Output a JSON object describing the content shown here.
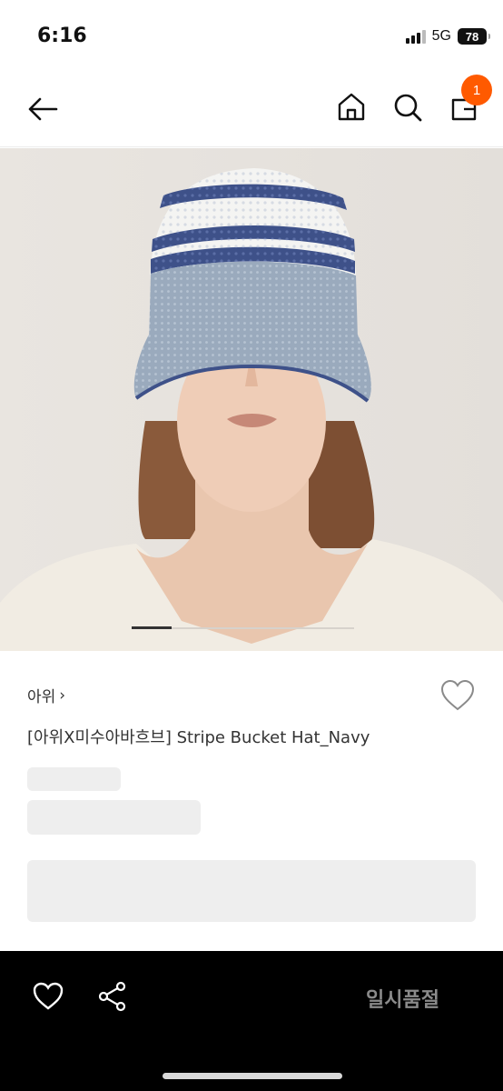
{
  "status_bar": {
    "time": "6:16",
    "network": "5G",
    "battery": "78"
  },
  "header": {
    "back_icon": "arrow-left-icon",
    "home_icon": "home-icon",
    "search_icon": "search-icon",
    "cart_icon": "shopping-bag-icon",
    "cart_count": "1",
    "badge_color": "#ff5a00"
  },
  "product": {
    "image_icon": "product-photo-crochet-bucket-hat",
    "carousel_progress": 0.18,
    "brand": "아위",
    "brand_chevron": "›",
    "title": "[아위X미수아바흐브] Stripe Bucket Hat_Navy",
    "wishlist_icon": "heart-outline-icon"
  },
  "bottom_bar": {
    "wishlist_icon": "heart-outline-icon",
    "share_icon": "share-icon",
    "soldout_label": "일시품절"
  },
  "colors": {
    "hat_navy": "#3e5189",
    "hat_grey_blue": "#9aaabd",
    "background": "#e6e2dd"
  }
}
